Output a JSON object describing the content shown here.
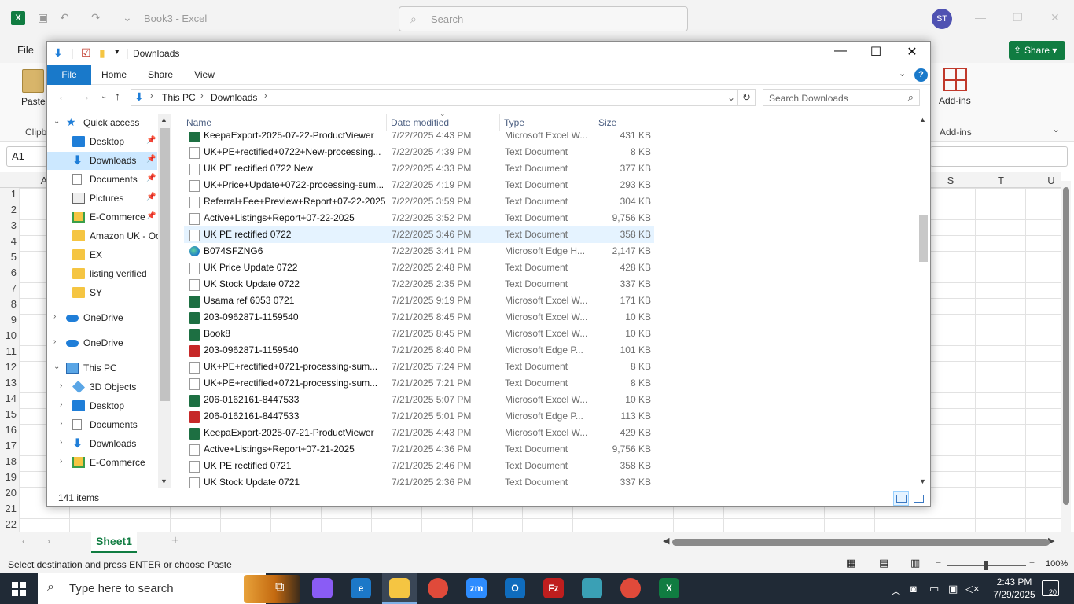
{
  "excel": {
    "doc_title": "Book3 - Excel",
    "search_placeholder": "Search",
    "avatar_initials": "ST",
    "menu_file": "File",
    "share_label": "Share",
    "paste_label": "Paste",
    "clipboard_group": "Clipb",
    "addins_label": "Add-ins",
    "addins_group": "Add-ins",
    "name_box": "A1",
    "col_headers_left": [
      "A"
    ],
    "col_headers_right": [
      "S",
      "T",
      "U"
    ],
    "row_numbers": [
      "1",
      "2",
      "3",
      "4",
      "5",
      "6",
      "7",
      "8",
      "9",
      "10",
      "11",
      "12",
      "13",
      "14",
      "15",
      "16",
      "17",
      "18",
      "19",
      "20",
      "21",
      "22"
    ],
    "sheet_tab": "Sheet1",
    "add_sheet": "+",
    "status_message": "Select destination and press ENTER or choose Paste",
    "zoom": "100%"
  },
  "explorer": {
    "title": "Downloads",
    "ribbon_tabs": [
      "File",
      "Home",
      "Share",
      "View"
    ],
    "breadcrumb": [
      "This PC",
      "Downloads"
    ],
    "search_placeholder": "Search Downloads",
    "columns": {
      "name": "Name",
      "date": "Date modified",
      "type": "Type",
      "size": "Size"
    },
    "nav": {
      "quick_access": "Quick access",
      "qa_items": [
        "Desktop",
        "Downloads",
        "Documents",
        "Pictures",
        "E-Commerce",
        "Amazon UK - Oc",
        "EX",
        "listing verified",
        "SY"
      ],
      "onedrive_1": "OneDrive",
      "onedrive_2": "OneDrive",
      "this_pc": "This PC",
      "pc_items": [
        "3D Objects",
        "Desktop",
        "Documents",
        "Downloads",
        "E-Commerce"
      ]
    },
    "files": [
      {
        "name": "KeepaExport-2025-07-22-ProductViewer",
        "date": "7/22/2025 4:43 PM",
        "type": "Microsoft Excel W...",
        "size": "431 KB",
        "icon": "excel"
      },
      {
        "name": "UK+PE+rectified+0722+New-processing...",
        "date": "7/22/2025 4:39 PM",
        "type": "Text Document",
        "size": "8 KB",
        "icon": "text"
      },
      {
        "name": "UK PE rectified 0722 New",
        "date": "7/22/2025 4:33 PM",
        "type": "Text Document",
        "size": "377 KB",
        "icon": "text"
      },
      {
        "name": "UK+Price+Update+0722-processing-sum...",
        "date": "7/22/2025 4:19 PM",
        "type": "Text Document",
        "size": "293 KB",
        "icon": "text"
      },
      {
        "name": "Referral+Fee+Preview+Report+07-22-2025",
        "date": "7/22/2025 3:59 PM",
        "type": "Text Document",
        "size": "304 KB",
        "icon": "text"
      },
      {
        "name": "Active+Listings+Report+07-22-2025",
        "date": "7/22/2025 3:52 PM",
        "type": "Text Document",
        "size": "9,756 KB",
        "icon": "text"
      },
      {
        "name": "UK PE rectified 0722",
        "date": "7/22/2025 3:46 PM",
        "type": "Text Document",
        "size": "358 KB",
        "icon": "text"
      },
      {
        "name": "B074SFZNG6",
        "date": "7/22/2025 3:41 PM",
        "type": "Microsoft Edge H...",
        "size": "2,147 KB",
        "icon": "edge"
      },
      {
        "name": "UK Price Update 0722",
        "date": "7/22/2025 2:48 PM",
        "type": "Text Document",
        "size": "428 KB",
        "icon": "text"
      },
      {
        "name": "UK Stock Update 0722",
        "date": "7/22/2025 2:35 PM",
        "type": "Text Document",
        "size": "337 KB",
        "icon": "text"
      },
      {
        "name": "Usama ref 6053 0721",
        "date": "7/21/2025 9:19 PM",
        "type": "Microsoft Excel W...",
        "size": "171 KB",
        "icon": "excel"
      },
      {
        "name": "203-0962871-1159540",
        "date": "7/21/2025 8:45 PM",
        "type": "Microsoft Excel W...",
        "size": "10 KB",
        "icon": "excel"
      },
      {
        "name": "Book8",
        "date": "7/21/2025 8:45 PM",
        "type": "Microsoft Excel W...",
        "size": "10 KB",
        "icon": "excel"
      },
      {
        "name": "203-0962871-1159540",
        "date": "7/21/2025 8:40 PM",
        "type": "Microsoft Edge P...",
        "size": "101 KB",
        "icon": "pdf"
      },
      {
        "name": "UK+PE+rectified+0721-processing-sum...",
        "date": "7/21/2025 7:24 PM",
        "type": "Text Document",
        "size": "8 KB",
        "icon": "text"
      },
      {
        "name": "UK+PE+rectified+0721-processing-sum...",
        "date": "7/21/2025 7:21 PM",
        "type": "Text Document",
        "size": "8 KB",
        "icon": "text"
      },
      {
        "name": "206-0162161-8447533",
        "date": "7/21/2025 5:07 PM",
        "type": "Microsoft Excel W...",
        "size": "10 KB",
        "icon": "excel"
      },
      {
        "name": "206-0162161-8447533",
        "date": "7/21/2025 5:01 PM",
        "type": "Microsoft Edge P...",
        "size": "113 KB",
        "icon": "pdf"
      },
      {
        "name": "KeepaExport-2025-07-21-ProductViewer",
        "date": "7/21/2025 4:43 PM",
        "type": "Microsoft Excel W...",
        "size": "429 KB",
        "icon": "excel"
      },
      {
        "name": "Active+Listings+Report+07-21-2025",
        "date": "7/21/2025 4:36 PM",
        "type": "Text Document",
        "size": "9,756 KB",
        "icon": "text"
      },
      {
        "name": "UK PE rectified 0721",
        "date": "7/21/2025 2:46 PM",
        "type": "Text Document",
        "size": "358 KB",
        "icon": "text"
      },
      {
        "name": "UK Stock Update 0721",
        "date": "7/21/2025 2:36 PM",
        "type": "Text Document",
        "size": "337 KB",
        "icon": "text"
      }
    ],
    "item_count": "141 items"
  },
  "taskbar": {
    "search_placeholder": "Type here to search",
    "time": "2:43 PM",
    "date": "7/29/2025",
    "notification_count": "20",
    "apps": [
      {
        "name": "Copilot",
        "color": "#8a5cf5",
        "glyph": ""
      },
      {
        "name": "Edge",
        "color": "#1c78c8",
        "glyph": "e"
      },
      {
        "name": "File Explorer",
        "color": "#f5c542",
        "glyph": ""
      },
      {
        "name": "Chrome",
        "color": "#e04a3a",
        "glyph": ""
      },
      {
        "name": "Zoom",
        "color": "#2d8cff",
        "glyph": "zm"
      },
      {
        "name": "Outlook",
        "color": "#0f6cbd",
        "glyph": "O"
      },
      {
        "name": "FileZilla",
        "color": "#bf1e1e",
        "glyph": "Fz"
      },
      {
        "name": "App",
        "color": "#3aa0b5",
        "glyph": ""
      },
      {
        "name": "Chrome profile",
        "color": "#e04a3a",
        "glyph": ""
      },
      {
        "name": "Excel",
        "color": "#107c41",
        "glyph": "X"
      }
    ]
  }
}
